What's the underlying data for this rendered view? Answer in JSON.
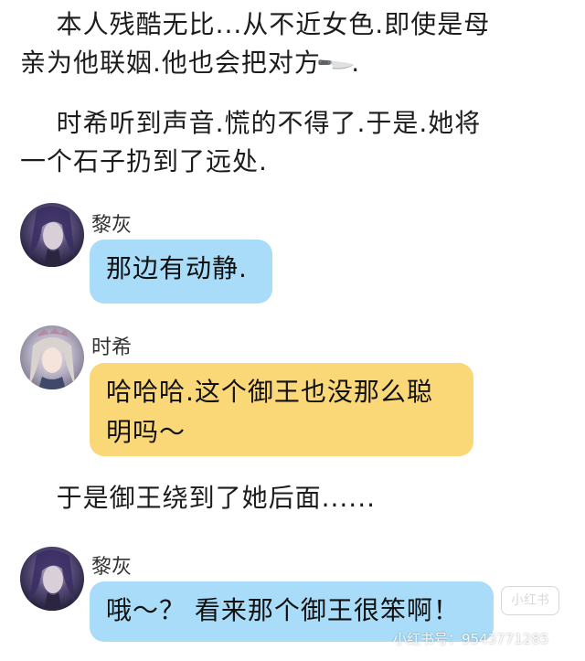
{
  "paragraphs": [
    {
      "line1": "    本人残酷无比...从不近女色.即使是母",
      "line2": "亲为他联姻.他也会把对方",
      "line2_end": ".",
      "emoji": "🔪"
    },
    {
      "line1": "    时希听到声音.慌的不得了.于是.她将",
      "line2": "一个石子扔到了远处."
    }
  ],
  "messages": [
    {
      "sender": "黎灰",
      "lines": [
        "那边有动静."
      ]
    },
    {
      "sender": "时希",
      "lines": [
        "哈哈哈.这个御王也没那么聪",
        "明吗～"
      ]
    },
    {
      "sender": "黎灰",
      "lines": [
        "哦～？ 看来那个御王很笨啊！"
      ]
    }
  ],
  "narration_mid": "    于是御王绕到了她后面......",
  "watermark": {
    "badge": "小红书",
    "id_text": "小红书号：9543771285"
  },
  "colors": {
    "blue_bubble": "#a9dcf8",
    "yellow_bubble": "#fbd877"
  }
}
